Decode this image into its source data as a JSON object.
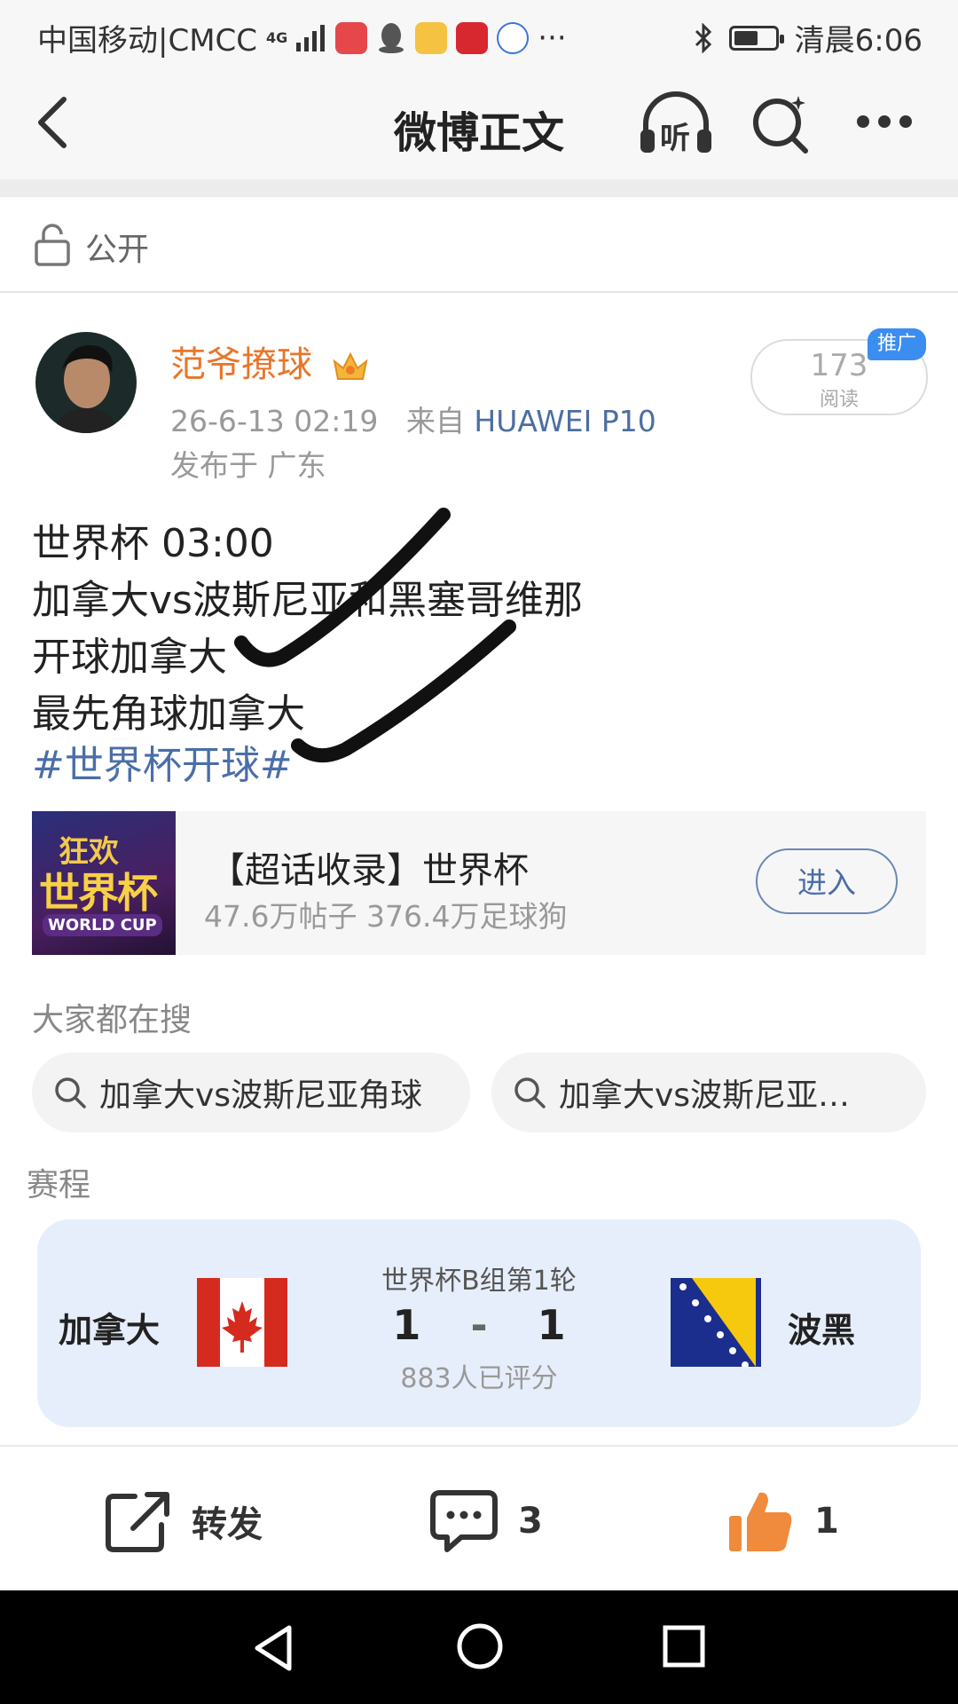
{
  "status_bar": {
    "carrier": "中国移动|CMCC",
    "network": "4G",
    "more": "···",
    "time": "清晨6:06"
  },
  "nav": {
    "title": "微博正文",
    "listen_label": "听"
  },
  "visibility": {
    "label": "公开"
  },
  "author": {
    "name": "范爷撩球",
    "timestamp": "26-6-13 02:19",
    "source_prefix": "来自",
    "device": "HUAWEI P10",
    "location": "发布于 广东"
  },
  "reads": {
    "count": "173",
    "label": "阅读",
    "badge": "推广"
  },
  "post": {
    "lines": [
      "世界杯 03:00",
      "加拿大vs波斯尼亚和黑塞哥维那",
      "开球加拿大",
      "最先角球加拿大"
    ],
    "hashtag": "#世界杯开球#"
  },
  "topic_card": {
    "thumb_line1": "狂欢",
    "thumb_line2": "世界杯",
    "thumb_line3": "WORLD CUP",
    "title": "【超话收录】世界杯",
    "stats": "47.6万帖子 376.4万足球狗",
    "enter_label": "进入"
  },
  "search": {
    "heading": "大家都在搜",
    "chips": [
      "加拿大vs波斯尼亚角球",
      "加拿大vs波斯尼亚…"
    ]
  },
  "schedule": {
    "heading": "赛程",
    "home_team": "加拿大",
    "away_team": "波黑",
    "round": "世界杯B组第1轮",
    "home_score": "1",
    "separator": "-",
    "away_score": "1",
    "ratings": "883人已评分"
  },
  "actions": {
    "repost_label": "转发",
    "comment_count": "3",
    "like_count": "1"
  },
  "colors": {
    "author_name": "#e8762b",
    "link": "#4b6ea8",
    "badge": "#3c8df0",
    "match_bg": "#e7eefb",
    "like": "#f08a3c"
  },
  "icons": [
    "back-icon",
    "listen-icon",
    "search-icon",
    "more-icon",
    "lock-icon",
    "crown-icon",
    "repost-icon",
    "comment-icon",
    "like-icon",
    "nav-back-icon",
    "nav-home-icon",
    "nav-recent-icon"
  ]
}
